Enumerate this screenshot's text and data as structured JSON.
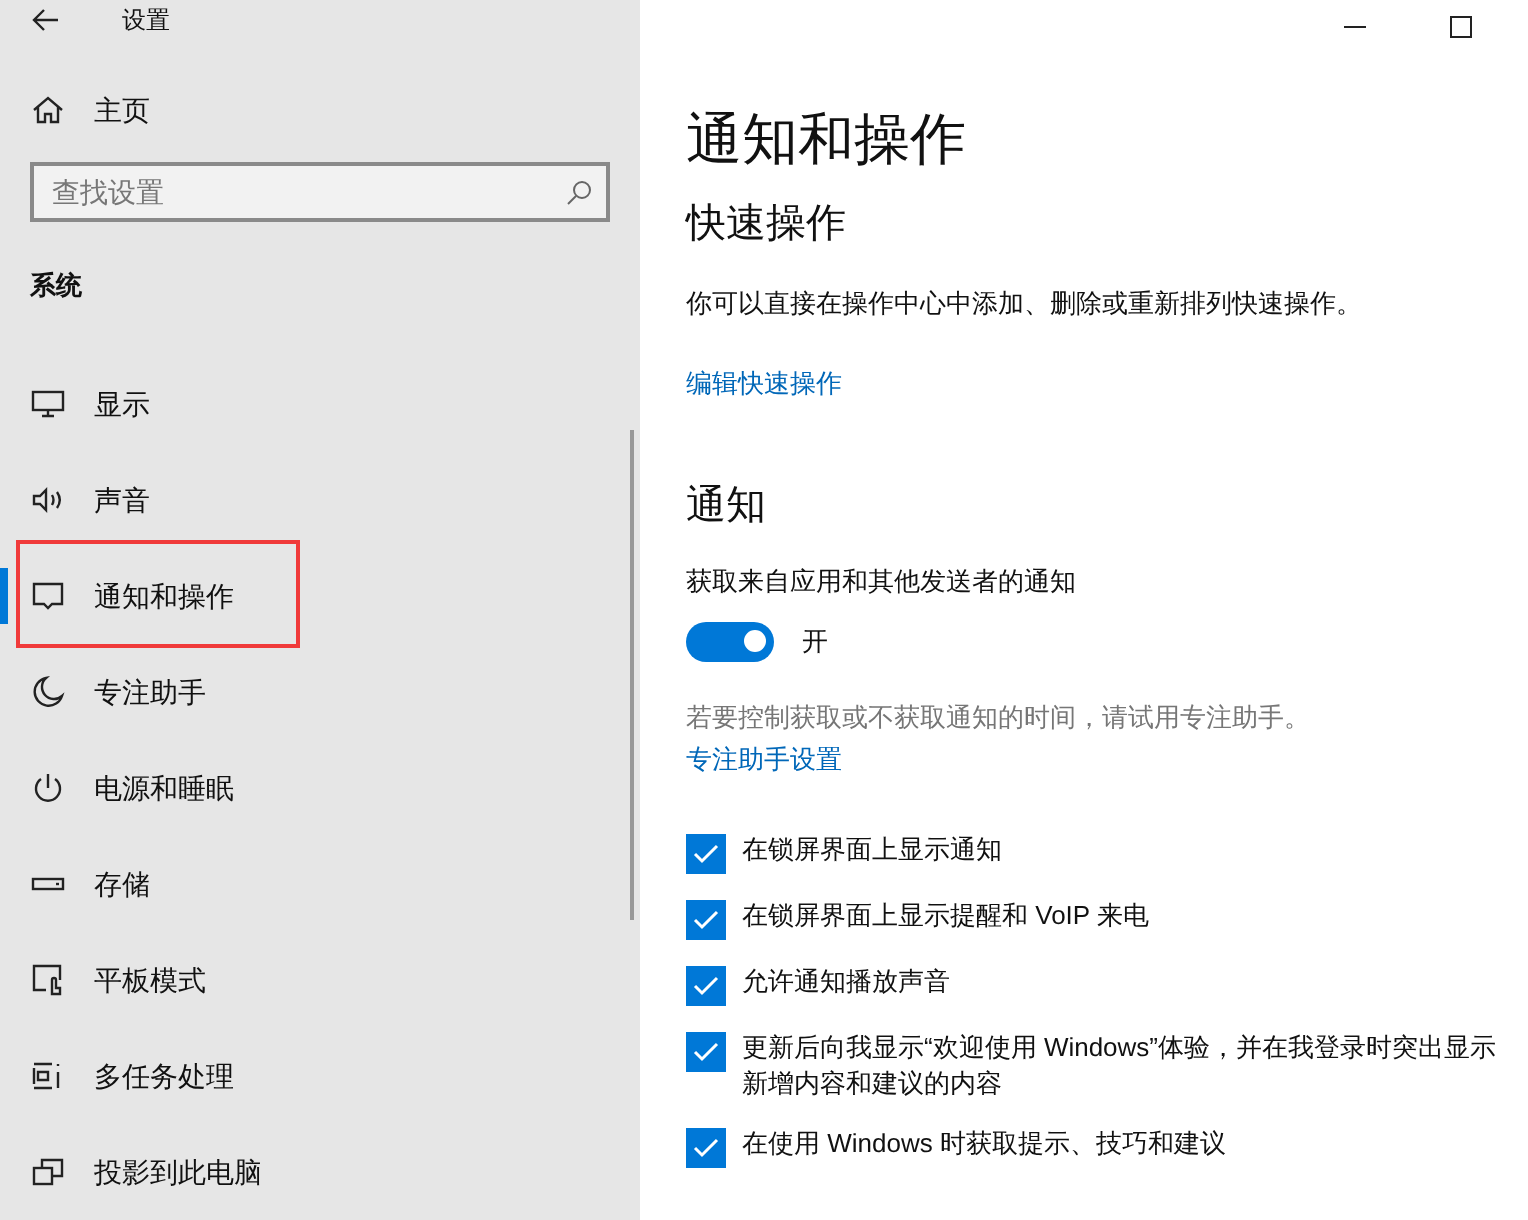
{
  "window": {
    "title": "设置"
  },
  "sidebar": {
    "home": "主页",
    "search": {
      "placeholder": "查找设置"
    },
    "section": "系统",
    "items": [
      {
        "label": "显示",
        "selected": false,
        "highlighted": false
      },
      {
        "label": "声音",
        "selected": false,
        "highlighted": false
      },
      {
        "label": "通知和操作",
        "selected": true,
        "highlighted": true
      },
      {
        "label": "专注助手",
        "selected": false,
        "highlighted": false
      },
      {
        "label": "电源和睡眠",
        "selected": false,
        "highlighted": false
      },
      {
        "label": "存储",
        "selected": false,
        "highlighted": false
      },
      {
        "label": "平板模式",
        "selected": false,
        "highlighted": false
      },
      {
        "label": "多任务处理",
        "selected": false,
        "highlighted": false
      },
      {
        "label": "投影到此电脑",
        "selected": false,
        "highlighted": false
      }
    ]
  },
  "page": {
    "title": "通知和操作",
    "quick": {
      "heading": "快速操作",
      "description": "你可以直接在操作中心中添加、删除或重新排列快速操作。",
      "link": "编辑快速操作"
    },
    "notifications": {
      "heading": "通知",
      "toggle_label": "获取来自应用和其他发送者的通知",
      "toggle": {
        "on": true,
        "state_text": "开"
      },
      "hint": "若要控制获取或不获取通知的时间，请试用专注助手。",
      "hint_link": "专注助手设置",
      "options": [
        {
          "label": "在锁屏界面上显示通知",
          "checked": true
        },
        {
          "label": "在锁屏界面上显示提醒和 VoIP 来电",
          "checked": true
        },
        {
          "label": "允许通知播放声音",
          "checked": true
        },
        {
          "label": "更新后向我显示“欢迎使用 Windows”体验，并在我登录时突出显示新增内容和建议的内容",
          "checked": true
        },
        {
          "label": "在使用 Windows 时获取提示、技巧和建议",
          "checked": true
        }
      ]
    }
  }
}
